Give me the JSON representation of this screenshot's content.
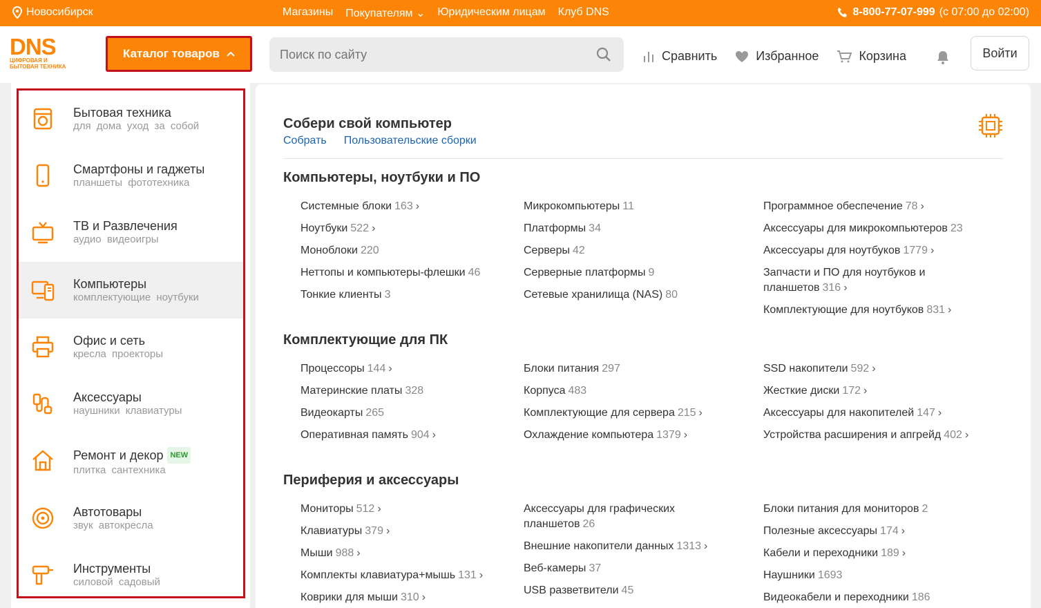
{
  "topbar": {
    "city": "Новосибирск",
    "nav": [
      "Магазины",
      "Покупателям",
      "Юридическим лицам",
      "Клуб DNS"
    ],
    "phone": "8-800-77-07-999",
    "hours": "(с 07:00 до 02:00)"
  },
  "header": {
    "logo": "DNS",
    "logo_sub1": "ЦИФРОВАЯ И",
    "logo_sub2": "БЫТОВАЯ ТЕХНИКА",
    "catalog_label": "Каталог товаров",
    "search_placeholder": "Поиск по сайту",
    "compare": "Сравнить",
    "favorites": "Избранное",
    "cart": "Корзина",
    "login": "Войти"
  },
  "sidebar": {
    "items": [
      {
        "title": "Бытовая техника",
        "subs": "для дома уход за собой",
        "icon": "washer-icon"
      },
      {
        "title": "Смартфоны и гаджеты",
        "subs": "планшеты фототехника",
        "icon": "phone-icon"
      },
      {
        "title": "ТВ и Развлечения",
        "subs": "аудио видеоигры",
        "icon": "tv-icon"
      },
      {
        "title": "Компьютеры",
        "subs": "комплектующие ноутбуки",
        "icon": "computer-icon"
      },
      {
        "title": "Офис и сеть",
        "subs": "кресла проекторы",
        "icon": "printer-icon"
      },
      {
        "title": "Аксессуары",
        "subs": "наушники клавиатуры",
        "icon": "cable-icon"
      },
      {
        "title": "Ремонт и декор",
        "subs": "плитка сантехника",
        "icon": "house-icon",
        "badge": "NEW"
      },
      {
        "title": "Автотовары",
        "subs": "звук автокресла",
        "icon": "wheel-icon"
      },
      {
        "title": "Инструменты",
        "subs": "силовой садовый",
        "icon": "drill-icon"
      }
    ]
  },
  "main": {
    "builder_title": "Собери свой компьютер",
    "builder_links": [
      "Собрать",
      "Пользовательские сборки"
    ],
    "sections": [
      {
        "title": "Компьютеры, ноутбуки и ПО",
        "cols": [
          [
            {
              "name": "Системные блоки",
              "count": "163",
              "arrow": true
            },
            {
              "name": "Ноутбуки",
              "count": "522",
              "arrow": true
            },
            {
              "name": "Моноблоки",
              "count": "220",
              "arrow": false
            },
            {
              "name": "Неттопы и компьютеры-флешки",
              "count": "46",
              "arrow": false
            },
            {
              "name": "Тонкие клиенты",
              "count": "3",
              "arrow": false
            }
          ],
          [
            {
              "name": "Микрокомпьютеры",
              "count": "11",
              "arrow": false
            },
            {
              "name": "Платформы",
              "count": "34",
              "arrow": false
            },
            {
              "name": "Серверы",
              "count": "42",
              "arrow": false
            },
            {
              "name": "Серверные платформы",
              "count": "9",
              "arrow": false
            },
            {
              "name": "Сетевые хранилища (NAS)",
              "count": "80",
              "arrow": false
            }
          ],
          [
            {
              "name": "Программное обеспечение",
              "count": "78",
              "arrow": true
            },
            {
              "name": "Аксессуары для микрокомпьютеров",
              "count": "23",
              "arrow": false
            },
            {
              "name": "Аксессуары для ноутбуков",
              "count": "1779",
              "arrow": true
            },
            {
              "name": "Запчасти и ПО для ноутбуков и планшетов",
              "count": "316",
              "arrow": true
            },
            {
              "name": "Комплектующие для ноутбуков",
              "count": "831",
              "arrow": true
            }
          ]
        ]
      },
      {
        "title": "Комплектующие для ПК",
        "cols": [
          [
            {
              "name": "Процессоры",
              "count": "144",
              "arrow": true
            },
            {
              "name": "Материнские платы",
              "count": "328",
              "arrow": false
            },
            {
              "name": "Видеокарты",
              "count": "265",
              "arrow": false
            },
            {
              "name": "Оперативная память",
              "count": "904",
              "arrow": true
            }
          ],
          [
            {
              "name": "Блоки питания",
              "count": "297",
              "arrow": false
            },
            {
              "name": "Корпуса",
              "count": "483",
              "arrow": false
            },
            {
              "name": "Комплектующие для сервера",
              "count": "215",
              "arrow": true
            },
            {
              "name": "Охлаждение компьютера",
              "count": "1379",
              "arrow": true
            }
          ],
          [
            {
              "name": "SSD накопители",
              "count": "592",
              "arrow": true
            },
            {
              "name": "Жесткие диски",
              "count": "172",
              "arrow": true
            },
            {
              "name": "Аксессуары для накопителей",
              "count": "147",
              "arrow": true
            },
            {
              "name": "Устройства расширения и апгрейд",
              "count": "402",
              "arrow": true
            }
          ]
        ]
      },
      {
        "title": "Периферия и аксессуары",
        "cols": [
          [
            {
              "name": "Мониторы",
              "count": "512",
              "arrow": true
            },
            {
              "name": "Клавиатуры",
              "count": "379",
              "arrow": true
            },
            {
              "name": "Мыши",
              "count": "988",
              "arrow": true
            },
            {
              "name": "Комплекты клавиатура+мышь",
              "count": "131",
              "arrow": true
            },
            {
              "name": "Коврики для мыши",
              "count": "310",
              "arrow": true
            }
          ],
          [
            {
              "name": "Аксессуары для графических планшетов",
              "count": "26",
              "arrow": false
            },
            {
              "name": "Внешние накопители данных",
              "count": "1313",
              "arrow": true
            },
            {
              "name": "Веб-камеры",
              "count": "37",
              "arrow": false
            },
            {
              "name": "USB разветвители",
              "count": "45",
              "arrow": false
            }
          ],
          [
            {
              "name": "Блоки питания для мониторов",
              "count": "2",
              "arrow": false
            },
            {
              "name": "Полезные аксессуары",
              "count": "174",
              "arrow": true
            },
            {
              "name": "Кабели и переходники",
              "count": "189",
              "arrow": true
            },
            {
              "name": "Наушники",
              "count": "1693",
              "arrow": false
            },
            {
              "name": "Видеокабели и переходники",
              "count": "186",
              "arrow": false
            }
          ]
        ]
      }
    ]
  },
  "colors": {
    "brand": "#fc8507",
    "highlight": "#c4101a",
    "link": "#1b64b0"
  }
}
